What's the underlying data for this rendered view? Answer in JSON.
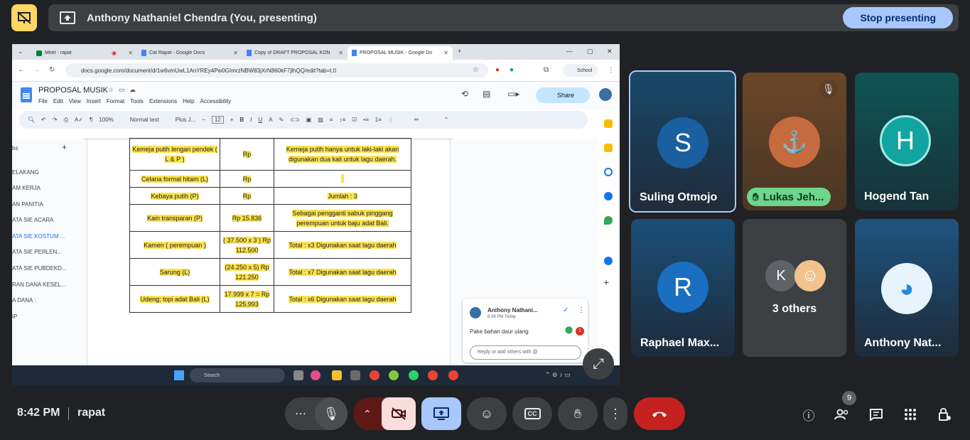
{
  "presenting": {
    "title": "Anthony Nathaniel Chendra (You, presenting)",
    "stop_label": "Stop presenting"
  },
  "browser": {
    "tabs": [
      {
        "label": "Meet - rapat"
      },
      {
        "label": "Cat Rapat - Google Docs"
      },
      {
        "label": "Copy of DRAFT PROPOSAL KON"
      },
      {
        "label": "PROPOSAL MUSIK - Google Do"
      }
    ],
    "url": "docs.google.com/document/d/1w6vmUwL1AnYREy4Pw0GImrzNBW83jXrN860kF7jlhQQ/edit?tab=t.0",
    "profile": "School"
  },
  "doc": {
    "title": "PROPOSAL MUSIK",
    "menu": [
      "File",
      "Edit",
      "View",
      "Insert",
      "Format",
      "Tools",
      "Extensions",
      "Help",
      "Accessibility"
    ],
    "share_label": "Share",
    "zoom": "100%",
    "style": "Normal text",
    "font": "Plus J...",
    "font_size": "12",
    "outline_items": [
      "bs",
      "ELAKANG",
      "AM KERJA",
      "AN PANITIA",
      "ATA SIE ACARA",
      "ATA SIE KOSTUM ...",
      "ATA SIE PERLEN...",
      "ATA SIE PUBDEKD...",
      "RAN DANA KESEL...",
      "A DANA :",
      "IP"
    ],
    "table": [
      {
        "item": "Kemeja putih lengan pendek ( L & P )",
        "price": "Rp",
        "note": "Kemeja putih hanya untuk laki-laki akan digunakan dua kali untuk lagu daerah."
      },
      {
        "item": "Celana formal hitam (L)",
        "price": "Rp",
        "note": ""
      },
      {
        "item": "Kebaya putih (P)",
        "price": "Rp",
        "note": "Jumlah : 3"
      },
      {
        "item": "Kain transparan (P)",
        "price": "Rp 15.836",
        "note": "Sebagai pengganti sabuk pinggang perempuan untuk baju adat Bali."
      },
      {
        "item": "Kamen ( perempuan )",
        "price": "( 37.500 x 3 ) Rp 112.500",
        "note": "Total : x3 Digunakan saat lagu daerah"
      },
      {
        "item": "Sarung (L)",
        "price": "(24.250 x 5) Rp 121.250",
        "note": "Total : x7 Digunakan saat lagu daerah"
      },
      {
        "item": "Udeng; topi adat Bali (L)",
        "price": "17.999 x 7 = Rp 125.993",
        "note": "Total : x6 Digunakan saat lagu daerah"
      }
    ],
    "comment": {
      "author": "Anthony Nathani...",
      "time": "8:38 PM Today",
      "text": "Pake bahan daur ulang",
      "reply_placeholder": "Reply or add others with @",
      "badge": "1"
    },
    "taskbar_search": "Search"
  },
  "participants": [
    {
      "name": "Suling Otmojo",
      "initial": "S",
      "color": "#1a5fa0"
    },
    {
      "name": "Lukas Jeh...",
      "hand": true
    },
    {
      "name": "Hogend Tan",
      "initial": "H",
      "color": "#12a4a0"
    },
    {
      "name": "Raphael Max...",
      "initial": "R",
      "color": "#1a6fc0"
    },
    {
      "name": "3 others",
      "initial": "K"
    },
    {
      "name": "Anthony Nat..."
    }
  ],
  "bottom": {
    "time": "8:42 PM",
    "meeting": "rapat",
    "people_count": "9"
  },
  "colors": {
    "stop_button": "#a8c7fa",
    "end_call": "#c5221f",
    "present_active": "#a8c7fa",
    "camera_off": "#f9dedc"
  }
}
